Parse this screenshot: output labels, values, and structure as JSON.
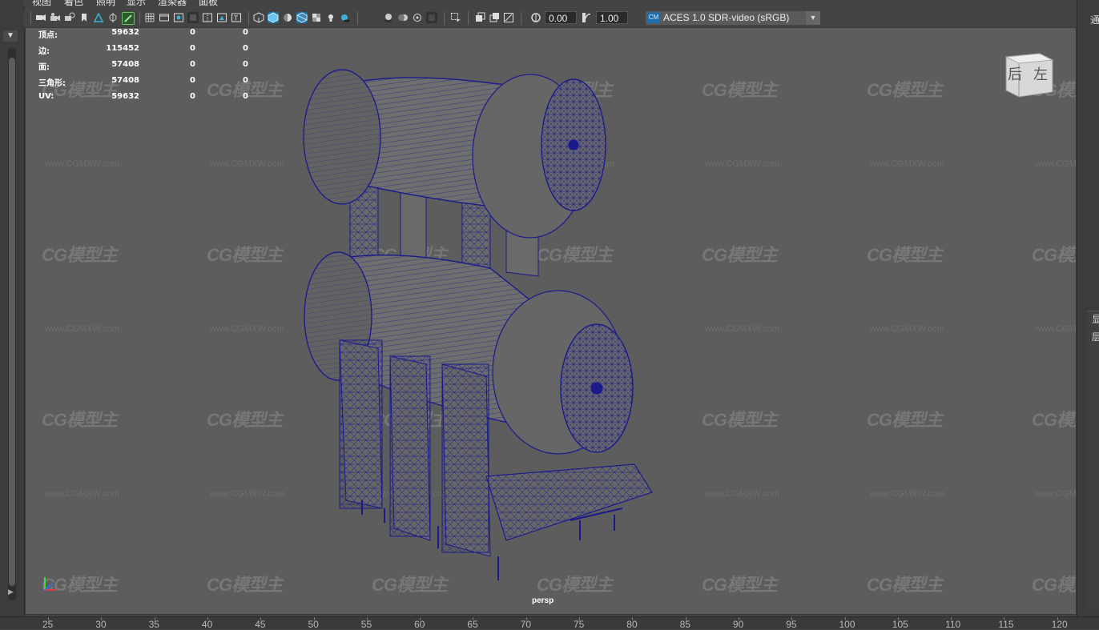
{
  "menu": [
    "视图",
    "着色",
    "照明",
    "显示",
    "渲染器",
    "面板"
  ],
  "toolbar": {
    "exposure_value": "0.00",
    "gamma_value": "1.00",
    "color_space": "ACES 1.0 SDR-video (sRGB)"
  },
  "hud": {
    "rows": [
      {
        "label": "顶点:",
        "v1": "59632",
        "v2": "0",
        "v3": "0"
      },
      {
        "label": "边:",
        "v1": "115452",
        "v2": "0",
        "v3": "0"
      },
      {
        "label": "面:",
        "v1": "57408",
        "v2": "0",
        "v3": "0"
      },
      {
        "label": "三角形:",
        "v1": "57408",
        "v2": "0",
        "v3": "0"
      },
      {
        "label": "UV:",
        "v1": "59632",
        "v2": "0",
        "v3": "0"
      }
    ]
  },
  "viewcube": {
    "back_label": "后",
    "left_label": "左"
  },
  "camera_label": "persp",
  "watermark": {
    "logo": "CG模型主",
    "url": "www.CGMXW.com"
  },
  "right_panel": {
    "top_label": "通",
    "label1": "显",
    "label2": "层"
  },
  "ruler": {
    "ticks": [
      "25",
      "30",
      "35",
      "40",
      "45",
      "50",
      "55",
      "60",
      "65",
      "70",
      "75",
      "80",
      "85",
      "90",
      "95",
      "100",
      "105",
      "110",
      "115",
      "120"
    ]
  },
  "colors": {
    "viewport_bg": "#5d5d5d",
    "wireframe": "#1a1a8c",
    "ui_bg": "#444444",
    "accent": "#1d6fb0"
  }
}
